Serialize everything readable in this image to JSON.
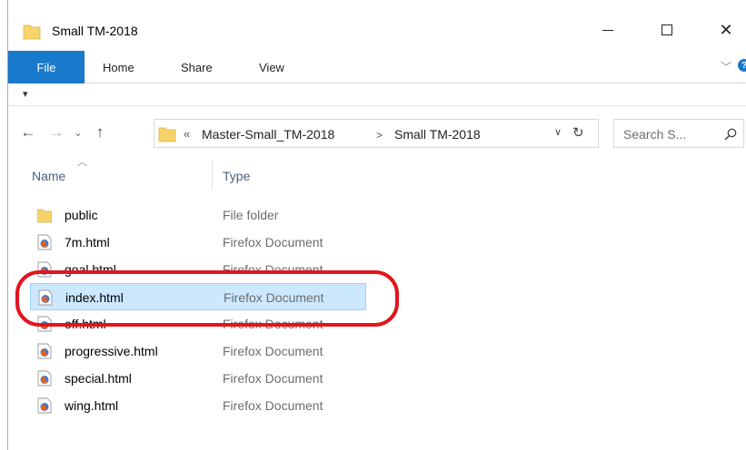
{
  "window": {
    "title": "Small TM-2018"
  },
  "ribbon": {
    "tabs": [
      {
        "label": "File"
      },
      {
        "label": "Home"
      },
      {
        "label": "Share"
      },
      {
        "label": "View"
      }
    ],
    "help_label": "?"
  },
  "nav": {
    "breadcrumb_overflow": "«",
    "path": [
      "Master-Small_TM-2018",
      "Small TM-2018"
    ],
    "separator": ">"
  },
  "search": {
    "placeholder": "Search S..."
  },
  "columns": {
    "name": "Name",
    "type": "Type"
  },
  "files": [
    {
      "name": "public",
      "type": "File folder",
      "icon": "folder-icon"
    },
    {
      "name": "7m.html",
      "type": "Firefox Document",
      "icon": "firefox-document-icon"
    },
    {
      "name": "goal.html",
      "type": "Firefox Document",
      "icon": "firefox-document-icon"
    },
    {
      "name": "index.html",
      "type": "Firefox Document",
      "icon": "firefox-document-icon",
      "selected": true
    },
    {
      "name": "off.html",
      "type": "Firefox Document",
      "icon": "firefox-document-icon"
    },
    {
      "name": "progressive.html",
      "type": "Firefox Document",
      "icon": "firefox-document-icon"
    },
    {
      "name": "special.html",
      "type": "Firefox Document",
      "icon": "firefox-document-icon"
    },
    {
      "name": "wing.html",
      "type": "Firefox Document",
      "icon": "firefox-document-icon"
    }
  ],
  "colors": {
    "accent": "#1979ca",
    "selection_bg": "#cce8ff",
    "selection_border": "#99d1ff",
    "annotation": "#e2141d",
    "folder": "#f7d46b"
  }
}
